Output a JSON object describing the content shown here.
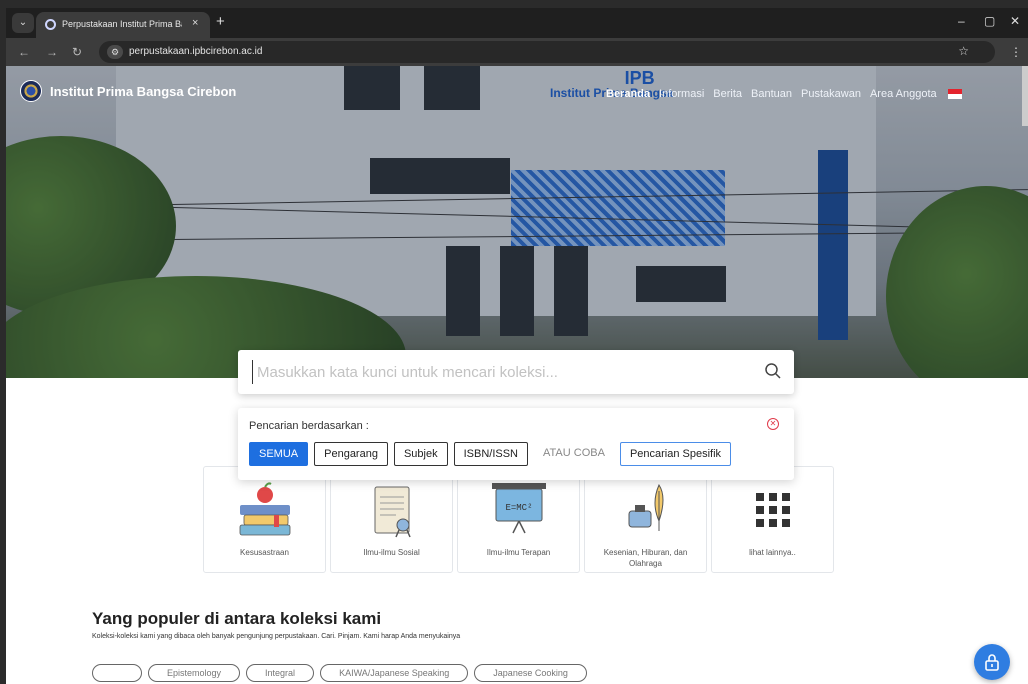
{
  "browser": {
    "tab_title": "Perpustakaan Institut Prima Bangsa Cirebon",
    "close_tab": "×",
    "new_tab": "+",
    "url": "perpustakaan.ipbcirebon.ac.id"
  },
  "site": {
    "brand_name": "Institut Prima Bangsa Cirebon",
    "sign_big": "IPB",
    "sign_small": "Institut Prima Bangsa"
  },
  "nav": {
    "items": [
      "Beranda",
      "Informasi",
      "Berita",
      "Bantuan",
      "Pustakawan",
      "Area Anggota"
    ],
    "active": "Beranda"
  },
  "search": {
    "placeholder": "Masukkan kata kunci untuk mencari koleksi..."
  },
  "filter": {
    "label": "Pencarian berdasarkan :",
    "buttons": [
      "SEMUA",
      "Pengarang",
      "Subjek",
      "ISBN/ISSN"
    ],
    "or_label": "ATAU COBA",
    "specific": "Pencarian Spesifik"
  },
  "categories": [
    {
      "label": "Kesusastraan",
      "icon": "books-apple-icon"
    },
    {
      "label": "Ilmu-ilmu Sosial",
      "icon": "certificate-icon"
    },
    {
      "label": "Ilmu-ilmu Terapan",
      "icon": "blackboard-icon",
      "board_text": "E=MC²"
    },
    {
      "label": "Kesenian, Hiburan, dan Olahraga",
      "icon": "ink-quill-icon"
    },
    {
      "label": "lihat lainnya..",
      "icon": "grid-icon"
    }
  ],
  "popular": {
    "title": "Yang populer di antara koleksi kami",
    "subtitle": "Koleksi-koleksi kami yang dibaca oleh banyak pengunjung perpustakaan. Cari. Pinjam. Kami harap Anda menyukainya",
    "chips": [
      "",
      "Epistemology",
      "Integral",
      "KAIWA/Japanese Speaking",
      "Japanese Cooking"
    ]
  },
  "colors": {
    "accent": "#1e6fe0",
    "close": "#e03a4a"
  }
}
